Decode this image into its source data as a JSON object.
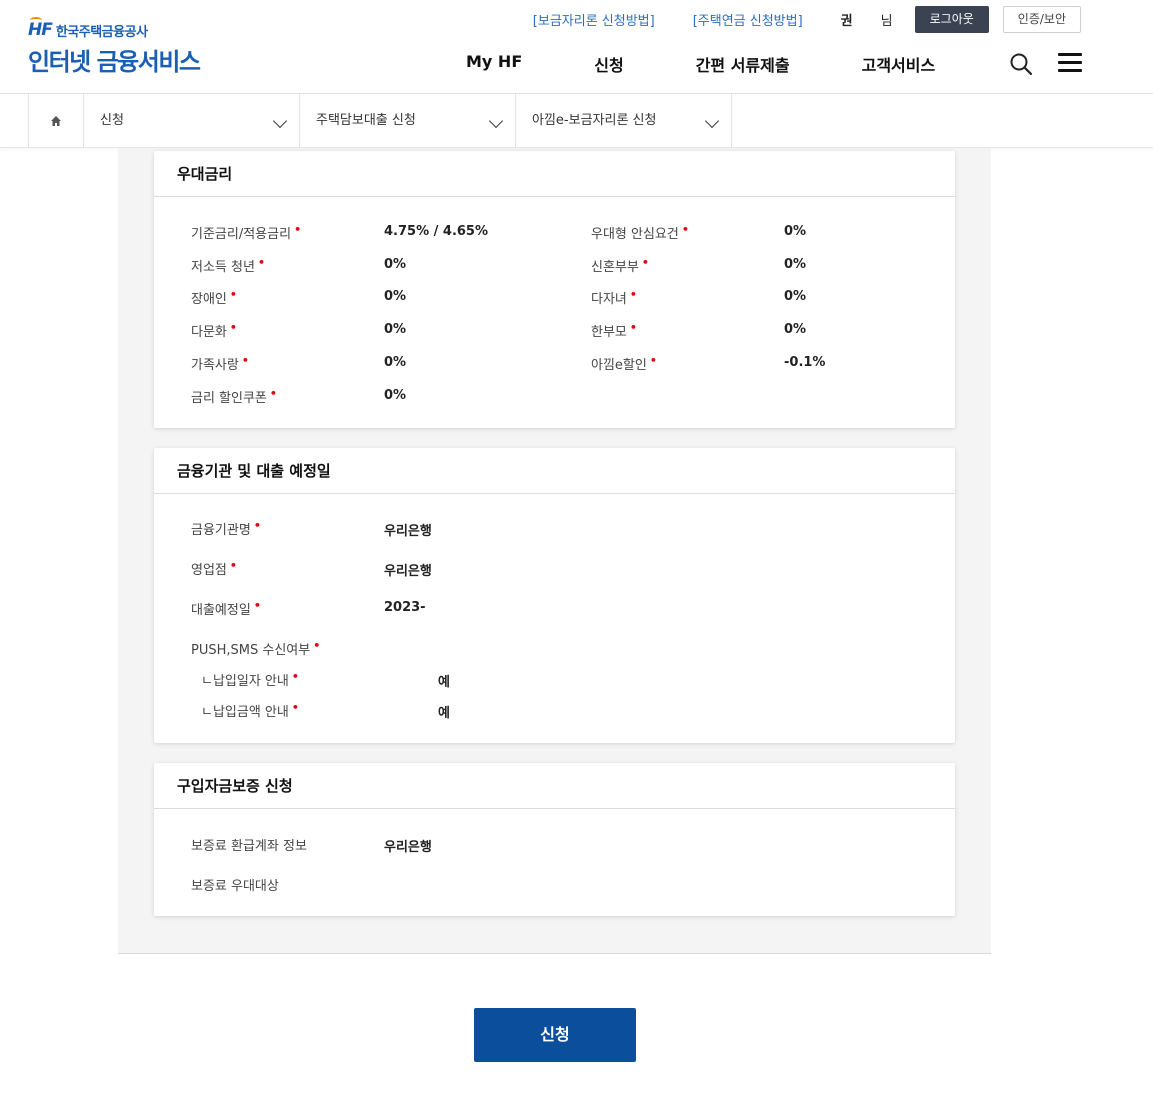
{
  "header": {
    "org_name": "한국주택금융공사",
    "logo_mark": "HF",
    "service_title": "인터넷 금융서비스",
    "util_links": [
      "[보금자리론 신청방법]",
      "[주택연금 신청방법]"
    ],
    "user_name": "권",
    "user_suffix": "님",
    "logout_label": "로그아웃",
    "cert_label": "인증/보안",
    "gnb": [
      "My HF",
      "신청",
      "간편 서류제출",
      "고객서비스"
    ]
  },
  "breadcrumb": {
    "items": [
      "신청",
      "주택담보대출 신청",
      "아낌e-보금자리론 신청"
    ]
  },
  "section_rate": {
    "title": "우대금리",
    "left": [
      {
        "label": "기준금리/적용금리",
        "value": "4.75% / 4.65%"
      },
      {
        "label": "저소득 청년",
        "value": "0%"
      },
      {
        "label": "장애인",
        "value": "0%"
      },
      {
        "label": "다문화",
        "value": "0%"
      },
      {
        "label": "가족사랑",
        "value": "0%"
      },
      {
        "label": "금리 할인쿠폰",
        "value": "0%"
      }
    ],
    "right": [
      {
        "label": "우대형 안심요건",
        "value": "0%"
      },
      {
        "label": "신혼부부",
        "value": "0%"
      },
      {
        "label": "다자녀",
        "value": "0%"
      },
      {
        "label": "한부모",
        "value": "0%"
      },
      {
        "label": "아낌e할인",
        "value": "-0.1%"
      }
    ]
  },
  "section_bank": {
    "title": "금융기관 및 대출 예정일",
    "rows": [
      {
        "label": "금융기관명",
        "value": "우리은행"
      },
      {
        "label": "영업점",
        "value": "우리은행"
      },
      {
        "label": "대출예정일",
        "value": "2023-"
      },
      {
        "label": "PUSH,SMS 수신여부",
        "value": ""
      }
    ],
    "sub_rows": [
      {
        "label": "ㄴ납입일자 안내",
        "value": "예"
      },
      {
        "label": "ㄴ납입금액 안내",
        "value": "예"
      }
    ]
  },
  "section_guarantee": {
    "title": "구입자금보증 신청",
    "rows": [
      {
        "label": "보증료 환급계좌 정보",
        "value": "우리은행"
      },
      {
        "label": "보증료 우대대상",
        "value": ""
      }
    ]
  },
  "submit_label": "신청",
  "colors": {
    "brand_blue": "#1a5fb4",
    "submit_blue": "#0b4f9c",
    "required_red": "#e60012",
    "link_blue": "#2b6fc2"
  }
}
